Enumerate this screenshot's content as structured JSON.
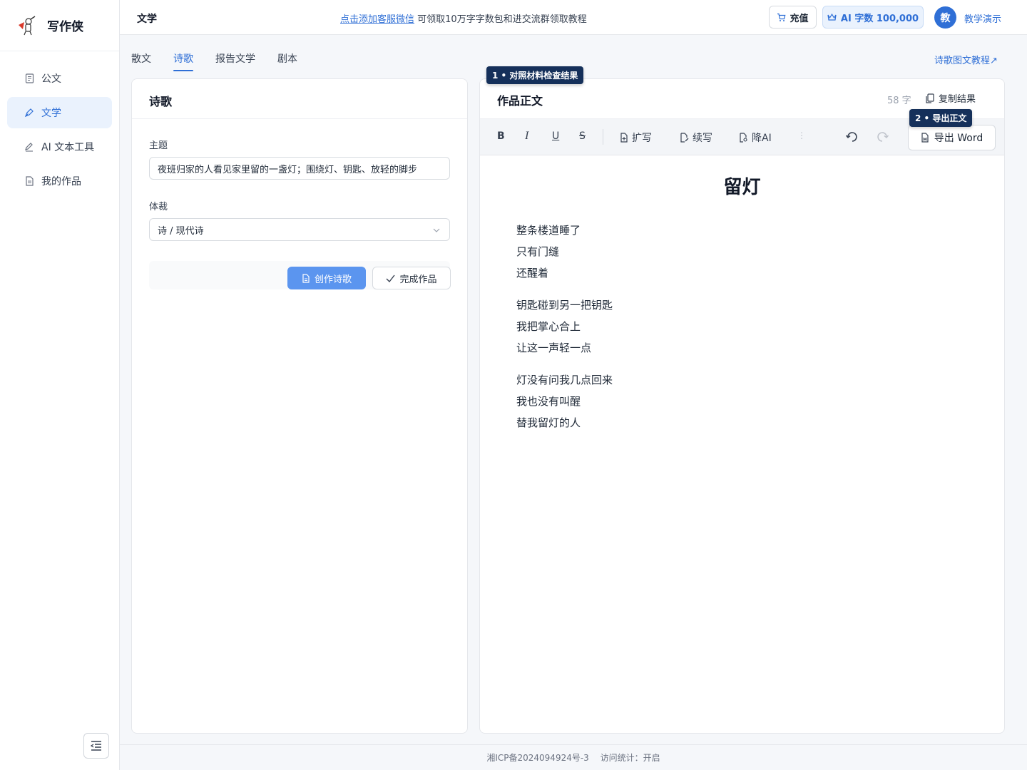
{
  "brand": {
    "name": "写作侠"
  },
  "sidebar": {
    "items": [
      {
        "label": "公文",
        "icon": "document-icon",
        "active": false
      },
      {
        "label": "文学",
        "icon": "pen-nib-icon",
        "active": true
      },
      {
        "label": "AI 文本工具",
        "icon": "edit-icon",
        "active": false
      },
      {
        "label": "我的作品",
        "icon": "file-icon",
        "active": false
      }
    ]
  },
  "header": {
    "title": "文学",
    "promo_link": "点击添加客服微信",
    "promo_text": " 可领取10万字字数包和进交流群领取教程",
    "recharge_label": "充值",
    "ai_count_label": "AI 字数 100,000",
    "avatar_char": "教",
    "user_name": "教学演示"
  },
  "tabs": [
    {
      "label": "散文",
      "active": false
    },
    {
      "label": "诗歌",
      "active": true
    },
    {
      "label": "报告文学",
      "active": false
    },
    {
      "label": "剧本",
      "active": false
    }
  ],
  "tutorial_link": "诗歌图文教程↗",
  "form": {
    "panel_title": "诗歌",
    "topic_label": "主题",
    "topic_value": "夜班归家的人看见家里留的一盏灯；围绕灯、钥匙、放轻的脚步",
    "genre_label": "体裁",
    "genre_value": "诗 / 现代诗",
    "create_button": "创作诗歌",
    "finish_button": "完成作品"
  },
  "editor": {
    "title": "作品正文",
    "word_count": "58 字",
    "copy_label": "复制结果",
    "toolbar": {
      "bold": "B",
      "italic": "I",
      "underline": "U",
      "strike": "S",
      "expand": "扩写",
      "continue": "续写",
      "reduce_ai": "降AI",
      "more": "⋮",
      "export": "导出 Word"
    },
    "doc_title": "留灯",
    "stanzas": [
      [
        "整条楼道睡了",
        "只有门缝",
        "还醒着"
      ],
      [
        "钥匙碰到另一把钥匙",
        "我把掌心合上",
        "让这一声轻一点"
      ],
      [
        "灯没有问我几点回来",
        "我也没有叫醒",
        "替我留灯的人"
      ]
    ]
  },
  "badges": {
    "badge1": "1 • 对照材料检查结果",
    "badge2": "2 • 导出正文"
  },
  "footer": {
    "icp": "湘ICP备2024094924号-3",
    "stats": "访问统计：开启"
  },
  "colors": {
    "accent": "#2f6fd6",
    "primary_button": "#5b95ef",
    "badge_bg": "#15305a"
  }
}
